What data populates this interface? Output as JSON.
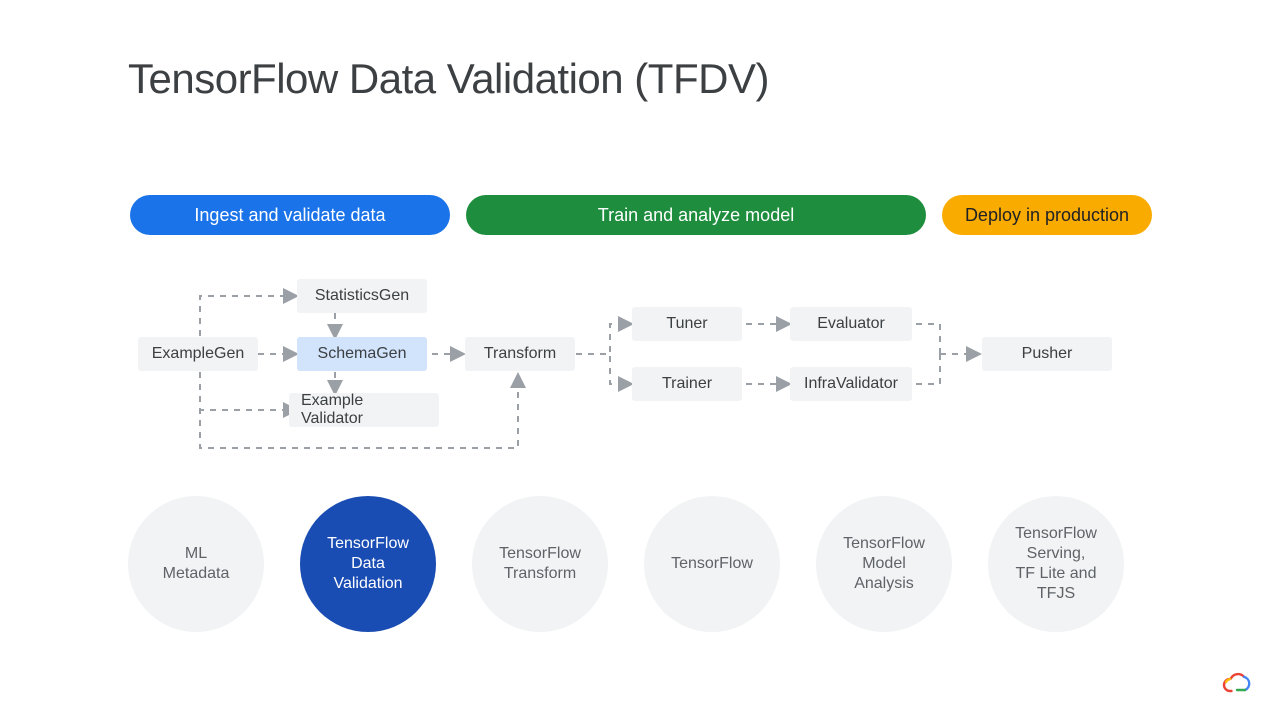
{
  "title": "TensorFlow Data Validation (TFDV)",
  "phases": {
    "ingest": "Ingest and validate data",
    "train": "Train and analyze model",
    "deploy": "Deploy in production"
  },
  "nodes": {
    "exampleGen": "ExampleGen",
    "statisticsGen": "StatisticsGen",
    "schemaGen": "SchemaGen",
    "exampleValidator": "Example Validator",
    "transform": "Transform",
    "tuner": "Tuner",
    "trainer": "Trainer",
    "evaluator": "Evaluator",
    "infraValidator": "InfraValidator",
    "pusher": "Pusher"
  },
  "libs": {
    "mlMetadata": "ML\nMetadata",
    "tfdv": "TensorFlow\nData\nValidation",
    "tfTransform": "TensorFlow\nTransform",
    "tensorflow": "TensorFlow",
    "tfma": "TensorFlow\nModel\nAnalysis",
    "serving": "TensorFlow\nServing,\nTF Lite and\nTFJS"
  }
}
